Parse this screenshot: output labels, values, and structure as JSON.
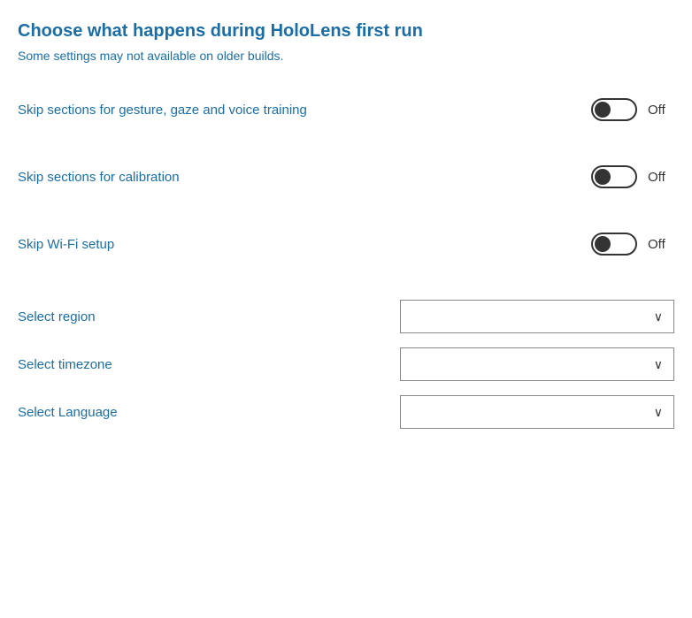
{
  "page": {
    "title": "Choose what happens during HoloLens first run",
    "subtitle": "Some settings may not available on older builds."
  },
  "settings": [
    {
      "id": "gesture-gaze-voice",
      "label": "Skip sections for gesture, gaze and voice training",
      "state": "Off"
    },
    {
      "id": "calibration",
      "label": "Skip sections for calibration",
      "state": "Off"
    },
    {
      "id": "wifi-setup",
      "label": "Skip Wi-Fi setup",
      "state": "Off"
    }
  ],
  "dropdowns": [
    {
      "id": "region",
      "label": "Select region"
    },
    {
      "id": "timezone",
      "label": "Select timezone"
    },
    {
      "id": "language",
      "label": "Select Language"
    }
  ]
}
